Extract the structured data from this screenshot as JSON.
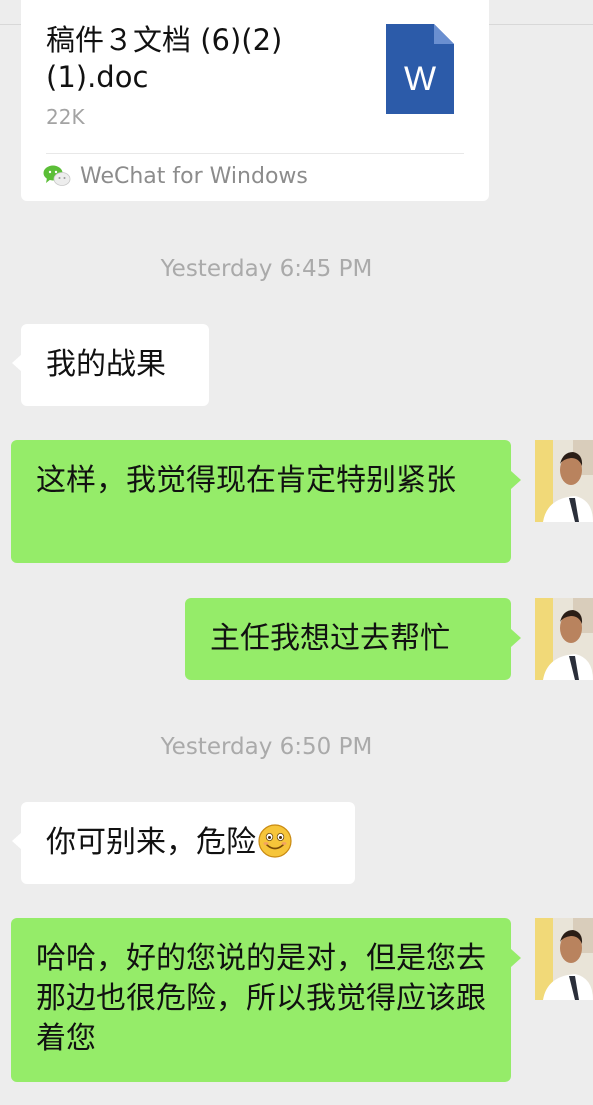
{
  "file_message": {
    "title": "稿件３文档 (6)(2)\n(1).doc",
    "size": "22K",
    "doc_icon_letter": "W",
    "source": "WeChat for Windows",
    "icon_color": "#2C5BA9"
  },
  "timestamps": [
    "Yesterday 6:45 PM",
    "Yesterday 6:50 PM"
  ],
  "messages": [
    {
      "direction": "incoming",
      "text": "我的战果"
    },
    {
      "direction": "outgoing",
      "text": "这样，我觉得现在肯定特别紧张"
    },
    {
      "direction": "outgoing",
      "text": "主任我想过去帮忙"
    },
    {
      "direction": "incoming",
      "text": "你可别来，危险",
      "emoji": "smile-emoji"
    },
    {
      "direction": "outgoing",
      "text": "哈哈，好的您说的是对，但是您去那边也很危险，所以我觉得应该跟着您"
    }
  ],
  "colors": {
    "background": "#EDEDED",
    "incoming_bubble": "#FFFFFF",
    "outgoing_bubble": "#95EC69",
    "timestamp_text": "#AAAAAA"
  }
}
